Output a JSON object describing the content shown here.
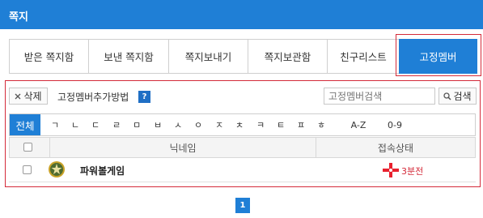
{
  "header": {
    "title": "쪽지"
  },
  "tabs": [
    "받은 쪽지함",
    "보낸 쪽지함",
    "쪽지보내기",
    "쪽지보관함",
    "친구리스트",
    "고정멤버"
  ],
  "toolbar": {
    "delete_label": "삭제",
    "add_method_label": "고정멤버추가방법",
    "help_label": "?",
    "search_placeholder": "고정멤버검색",
    "search_button_label": "검색"
  },
  "alpha_filter": {
    "all_label": "전체",
    "items": [
      "ㄱ",
      "ㄴ",
      "ㄷ",
      "ㄹ",
      "ㅁ",
      "ㅂ",
      "ㅅ",
      "ㅇ",
      "ㅈ",
      "ㅊ",
      "ㅋ",
      "ㅌ",
      "ㅍ",
      "ㅎ",
      "A-Z",
      "0-9"
    ]
  },
  "table": {
    "columns": [
      "닉네임",
      "접속상태"
    ],
    "rows": [
      {
        "nickname": "파워볼게임",
        "status": "3분전"
      }
    ]
  },
  "pagination": {
    "current": "1"
  },
  "colors": {
    "primary": "#1f7fd6",
    "highlight": "#d42b3a",
    "status": "#d42b3a"
  },
  "icons": {
    "avatar": "military-rank-badge-icon",
    "status": "red-cross-status-icon"
  }
}
